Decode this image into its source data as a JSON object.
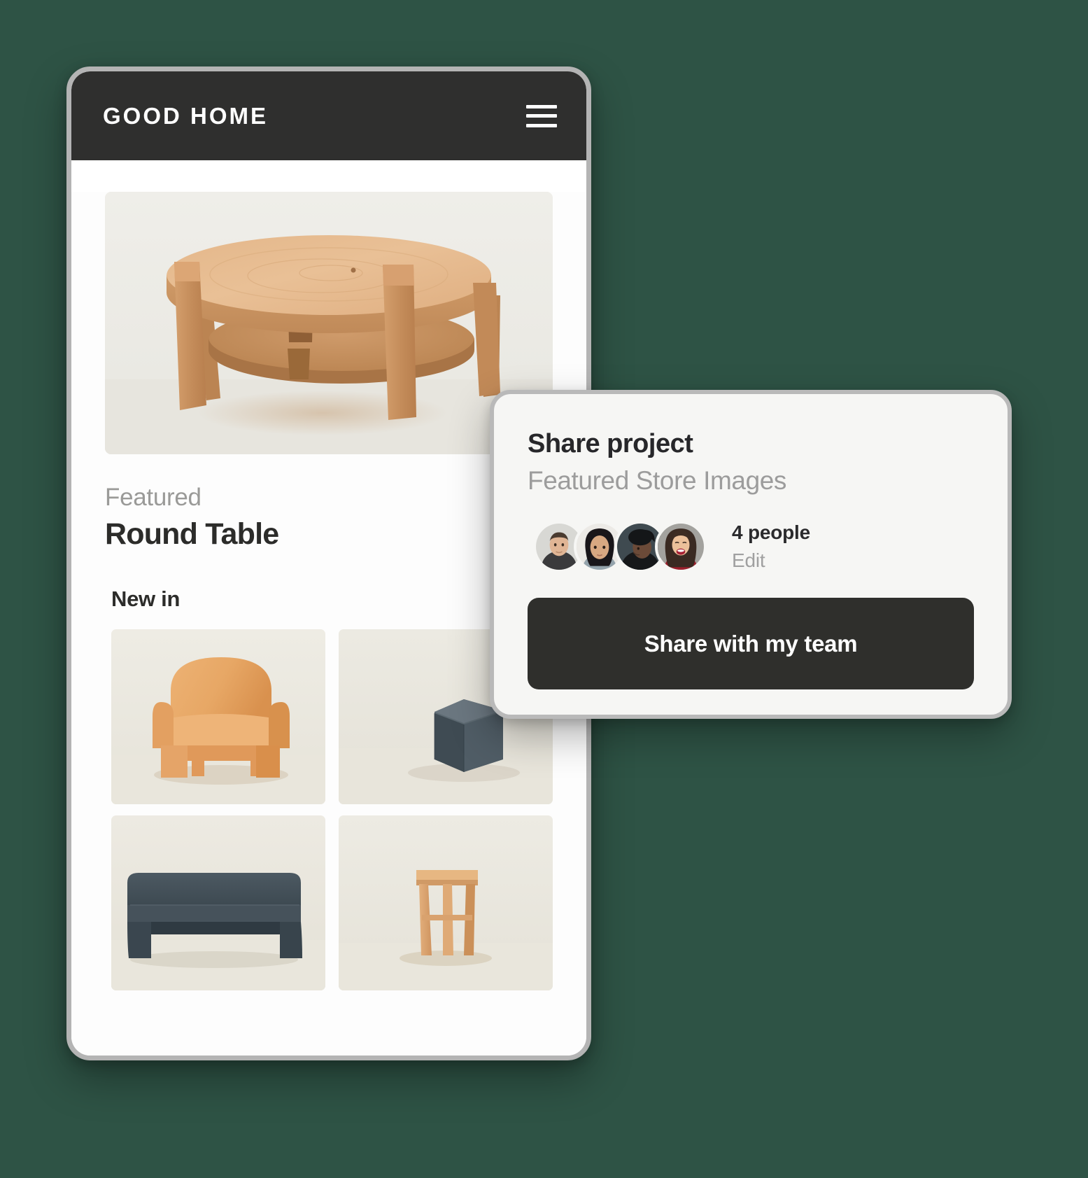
{
  "app": {
    "brand": "GOOD HOME",
    "menu_icon": "hamburger-menu-icon"
  },
  "hero": {
    "alt": "round-wooden-coffee-table-photo"
  },
  "featured": {
    "eyebrow": "Featured",
    "title": "Round Table"
  },
  "new_in": {
    "heading": "New in",
    "items": [
      {
        "name": "tan-upholstered-armchair"
      },
      {
        "name": "charcoal-hexagonal-ottoman"
      },
      {
        "name": "charcoal-upholstered-bench"
      },
      {
        "name": "wooden-side-stool"
      }
    ]
  },
  "share_card": {
    "title": "Share project",
    "subtitle": "Featured Store Images",
    "people_count": "4 people",
    "edit_label": "Edit",
    "button_label": "Share with my team",
    "avatars": [
      {
        "name": "avatar-person-1"
      },
      {
        "name": "avatar-person-2"
      },
      {
        "name": "avatar-person-3"
      },
      {
        "name": "avatar-person-4"
      }
    ]
  },
  "colors": {
    "page_background": "#2e5345",
    "header_dark": "#2f2f2e",
    "accent_dark": "#2f2f2c",
    "muted_text": "#9c9c9c",
    "card_background": "#f6f6f4"
  }
}
